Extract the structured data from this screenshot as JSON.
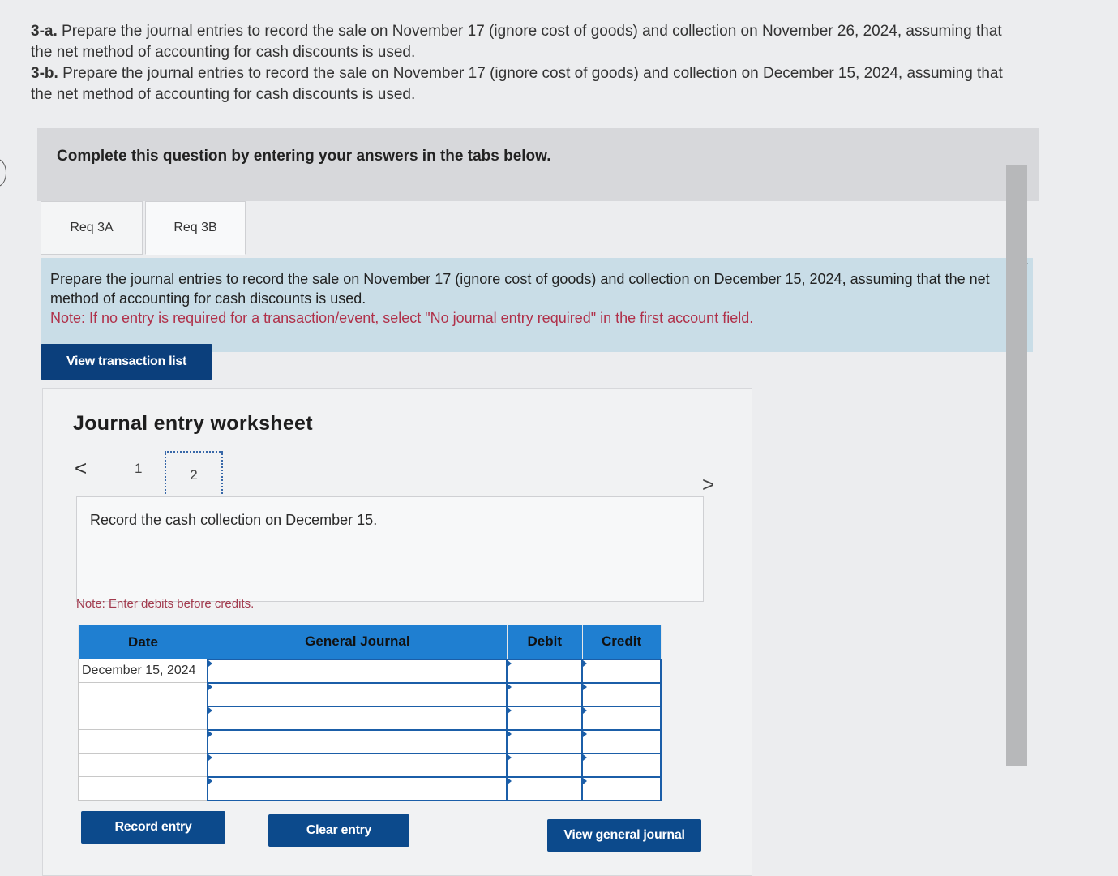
{
  "question": {
    "a_label": "3-a.",
    "a_text": "Prepare the journal entries to record the sale on November 17 (ignore cost of goods) and collection on November 26, 2024, assuming that the net method of accounting for cash discounts is used.",
    "b_label": "3-b.",
    "b_text": "Prepare the journal entries to record the sale on November 17 (ignore cost of goods) and collection on December 15, 2024, assuming that the net method of accounting for cash discounts is used."
  },
  "banner": {
    "text": "Complete this question by entering your answers in the tabs below."
  },
  "tabs": [
    {
      "label": "Req 3A"
    },
    {
      "label": "Req 3B"
    }
  ],
  "instructions": {
    "text": "Prepare the journal entries to record the sale on November 17 (ignore cost of goods) and collection on December 15, 2024, assuming that the net method of accounting for cash discounts is used.",
    "note": "Note: If no entry is required for a transaction/event, select \"No journal entry required\" in the first account field."
  },
  "buttons": {
    "view_transaction_list": "View transaction list",
    "record_entry": "Record entry",
    "clear_entry": "Clear entry",
    "view_general_journal": "View general journal"
  },
  "worksheet": {
    "title": "Journal entry worksheet",
    "pager": {
      "prev": "<",
      "page1": "1",
      "page2": "2",
      "next": ">"
    },
    "record_text": "Record the cash collection on December 15.",
    "note": "Note: Enter debits before credits."
  },
  "table": {
    "headers": {
      "date": "Date",
      "journal": "General Journal",
      "debit": "Debit",
      "credit": "Credit"
    },
    "rows": [
      {
        "date": "December 15, 2024",
        "journal": "",
        "debit": "",
        "credit": ""
      },
      {
        "date": "",
        "journal": "",
        "debit": "",
        "credit": ""
      },
      {
        "date": "",
        "journal": "",
        "debit": "",
        "credit": ""
      },
      {
        "date": "",
        "journal": "",
        "debit": "",
        "credit": ""
      },
      {
        "date": "",
        "journal": "",
        "debit": "",
        "credit": ""
      },
      {
        "date": "",
        "journal": "",
        "debit": "",
        "credit": ""
      }
    ]
  },
  "colors": {
    "primary_button": "#0c4a8c",
    "table_header": "#1f7fd1",
    "note_red": "#b0314a",
    "instruction_bg": "#c9dde7"
  }
}
